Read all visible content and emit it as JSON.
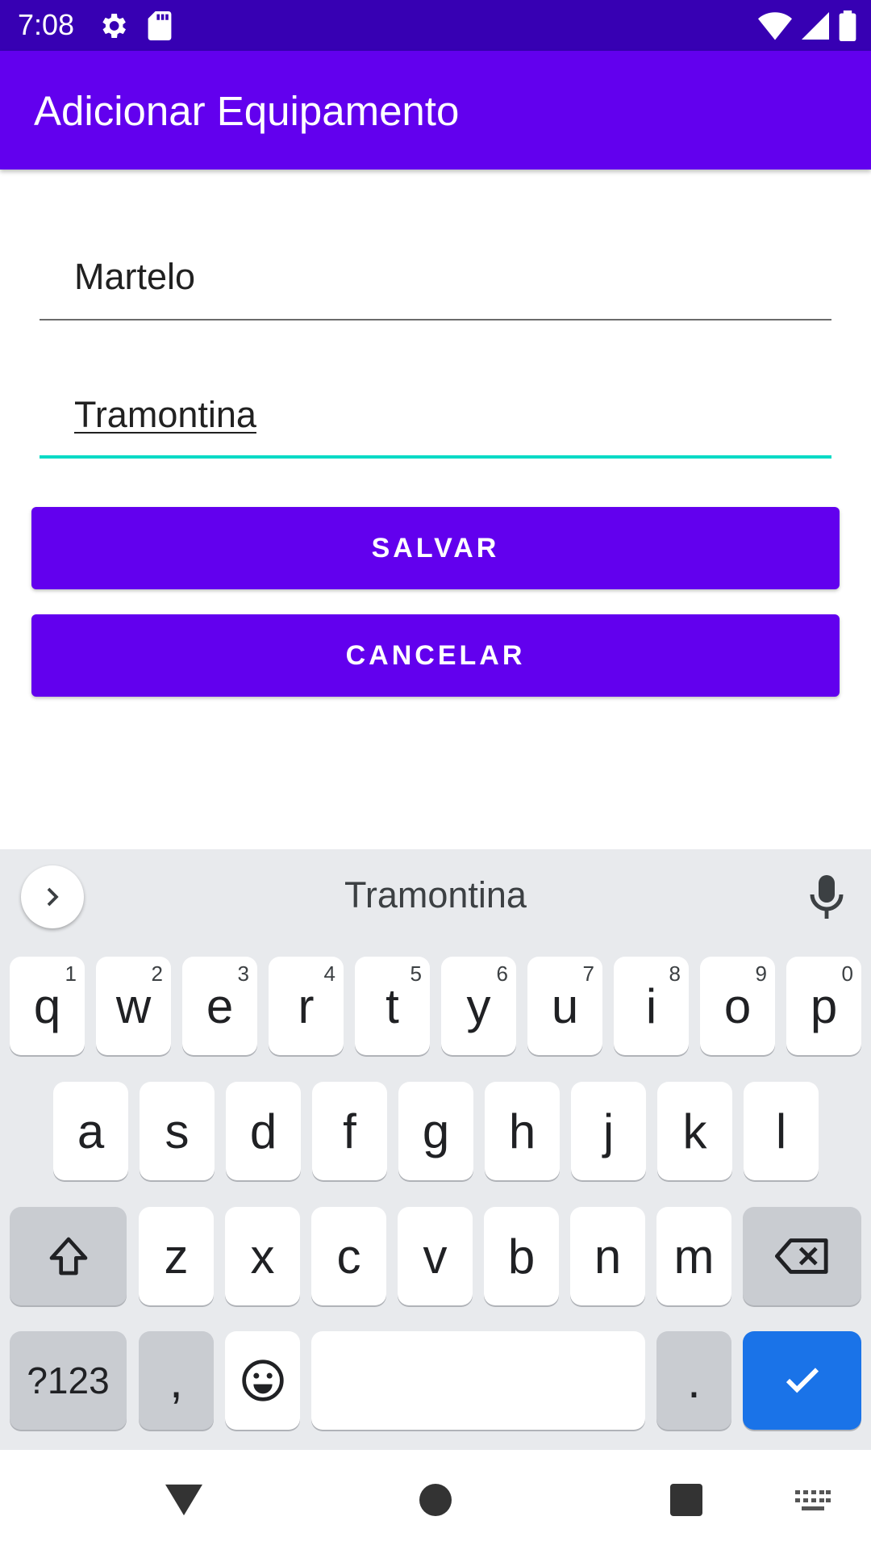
{
  "status_bar": {
    "time": "7:08"
  },
  "app_bar": {
    "title": "Adicionar Equipamento"
  },
  "form": {
    "field1_value": "Martelo",
    "field2_value": "Tramontina",
    "save_label": "SALVAR",
    "cancel_label": "CANCELAR"
  },
  "keyboard": {
    "suggestion": "Tramontina",
    "row1": [
      {
        "k": "q",
        "n": "1"
      },
      {
        "k": "w",
        "n": "2"
      },
      {
        "k": "e",
        "n": "3"
      },
      {
        "k": "r",
        "n": "4"
      },
      {
        "k": "t",
        "n": "5"
      },
      {
        "k": "y",
        "n": "6"
      },
      {
        "k": "u",
        "n": "7"
      },
      {
        "k": "i",
        "n": "8"
      },
      {
        "k": "o",
        "n": "9"
      },
      {
        "k": "p",
        "n": "0"
      }
    ],
    "row2": [
      "a",
      "s",
      "d",
      "f",
      "g",
      "h",
      "j",
      "k",
      "l"
    ],
    "row3": [
      "z",
      "x",
      "c",
      "v",
      "b",
      "n",
      "m"
    ],
    "symbols_label": "?123",
    "comma": ",",
    "period": "."
  },
  "colors": {
    "status_bar": "#3700b3",
    "primary": "#6200ee",
    "accent": "#03dac5",
    "enter_key": "#1a73e8"
  }
}
